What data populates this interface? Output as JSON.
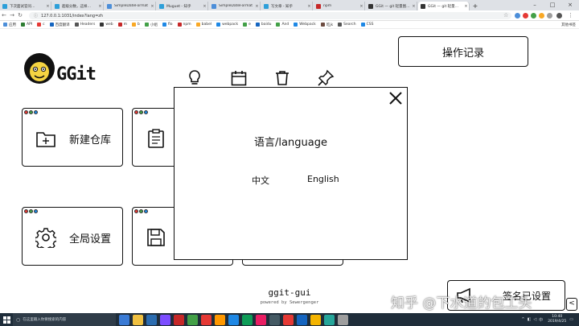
{
  "browser": {
    "tabs": [
      {
        "title": "下次面试官问…",
        "color": "#2d9fd9"
      },
      {
        "title": "超级分数，这样…",
        "color": "#2d9fd9"
      },
      {
        "title": "SimpleDateFormat",
        "color": "#4c8ed9"
      },
      {
        "title": "Muguet - 知乎",
        "color": "#2d9fd9"
      },
      {
        "title": "SimpleDateFormat",
        "color": "#4c8ed9"
      },
      {
        "title": "写文章 - 知乎",
        "color": "#2d9fd9"
      },
      {
        "title": "npm",
        "color": "#c62828"
      },
      {
        "title": "GGit — git 轻量图…",
        "color": "#333333"
      },
      {
        "title": "GGit — git 轻量…",
        "color": "#333333"
      }
    ],
    "url": "127.0.0.1:1031/index?lang=zh",
    "bookmarks": [
      {
        "label": "应用",
        "color": "#4c8ed9"
      },
      {
        "label": "API",
        "color": "#2e7d32"
      },
      {
        "label": "c",
        "color": "#e53935"
      },
      {
        "label": "百度翻译",
        "color": "#1565c0"
      },
      {
        "label": "Headers",
        "color": "#555555"
      },
      {
        "label": "web",
        "color": "#333333"
      },
      {
        "label": "m",
        "color": "#c62828"
      },
      {
        "label": "b",
        "color": "#f9a825"
      },
      {
        "label": "小组",
        "color": "#43a047"
      },
      {
        "label": "flo",
        "color": "#1e88e5"
      },
      {
        "label": "npm",
        "color": "#c62828"
      },
      {
        "label": "babel",
        "color": "#f9a825"
      },
      {
        "label": "webpack",
        "color": "#1e88e5"
      },
      {
        "label": "e",
        "color": "#43a047"
      },
      {
        "label": "baidu",
        "color": "#1565c0"
      },
      {
        "label": "And",
        "color": "#43a047"
      },
      {
        "label": "Webpack",
        "color": "#1e88e5"
      },
      {
        "label": "吃jk",
        "color": "#6d4c41"
      },
      {
        "label": "Search",
        "color": "#555555"
      },
      {
        "label": "CSS",
        "color": "#1e88e5"
      }
    ],
    "other_bookmarks": "其他书签"
  },
  "app": {
    "name": "GGit",
    "history_button": "操作记录",
    "cards": [
      {
        "label": "新建仓库",
        "icon": "folder-plus-icon"
      },
      {
        "label": "",
        "icon": "clipboard-icon"
      },
      {
        "label": "全局设置",
        "icon": "gear-icon"
      },
      {
        "label": "",
        "icon": "save-icon"
      }
    ],
    "footer_title": "ggit-gui",
    "footer_sub": "powered by Sewergenger",
    "alias_button": "签名已设置",
    "collapse_glyph": "<"
  },
  "modal": {
    "title": "语言/language",
    "options": [
      "中文",
      "English"
    ]
  },
  "watermark": "知乎 @下水道的包工头",
  "taskbar": {
    "search_placeholder": "在这里输入你要搜索的内容",
    "time": "10:40",
    "date": "2019/4/25",
    "apps": [
      "#3a7bd5",
      "#f0c040",
      "#2b6cb0",
      "#7c4dff",
      "#c62828",
      "#43a047",
      "#e53935",
      "#ff9800",
      "#1e88e5",
      "#0f9d58",
      "#e91e63",
      "#455a64",
      "#e53935",
      "#1565c0",
      "#f4b400",
      "#26a69a",
      "#9e9e9e"
    ]
  }
}
